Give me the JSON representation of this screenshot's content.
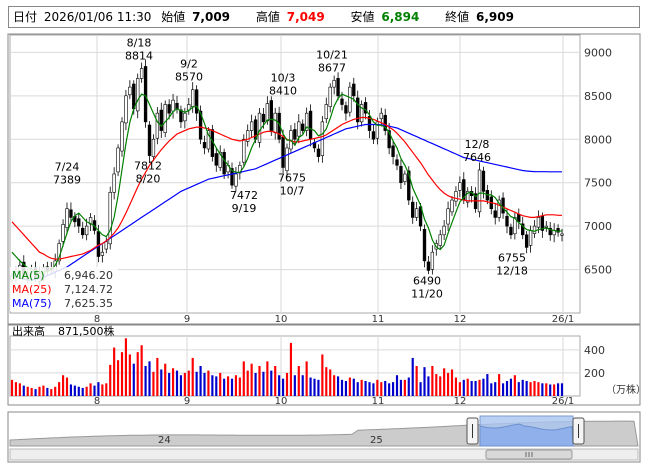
{
  "header": {
    "date_label": "日付",
    "date": "2026/01/06 11:30",
    "open_label": "始値",
    "open": "7,009",
    "high_label": "高値",
    "high": "7,049",
    "low_label": "安値",
    "low": "6,894",
    "close_label": "終値",
    "close": "6,909"
  },
  "colors": {
    "up": "#ff0000",
    "down": "#0000cc",
    "ma5": "#008000",
    "ma25": "#ff0000",
    "ma75": "#0000ff",
    "high_value": "#ff0000",
    "low_value": "#008000"
  },
  "chart_data": [
    {
      "type": "candlestick",
      "y_ticks": [
        "9000",
        "8500",
        "8000",
        "7500",
        "7000",
        "6500"
      ],
      "ylim": [
        6000,
        9200
      ],
      "x_ticks": [
        "8",
        "9",
        "10",
        "11",
        "12",
        "26/1"
      ],
      "legend": [
        {
          "label": "MA(5)",
          "value": "6,946.20"
        },
        {
          "label": "MA(25)",
          "value": "7,124.72"
        },
        {
          "label": "MA(75)",
          "value": "7,625.35"
        }
      ],
      "annotations": [
        {
          "lines": [
            "7/24",
            "7389"
          ],
          "value": 7389
        },
        {
          "lines": [
            "8/18",
            "8814"
          ],
          "value": 8814
        },
        {
          "lines": [
            "7812",
            "8/20"
          ],
          "value": 7812
        },
        {
          "lines": [
            "9/2",
            "8570"
          ],
          "value": 8570
        },
        {
          "lines": [
            "7472",
            "9/19"
          ],
          "value": 7472
        },
        {
          "lines": [
            "10/3",
            "8410"
          ],
          "value": 8410
        },
        {
          "lines": [
            "7675",
            "10/7"
          ],
          "value": 7675
        },
        {
          "lines": [
            "10/21",
            "8677"
          ],
          "value": 8677
        },
        {
          "lines": [
            "6490",
            "11/20"
          ],
          "value": 6490
        },
        {
          "lines": [
            "12/8",
            "7646"
          ],
          "value": 7646
        },
        {
          "lines": [
            "6755",
            "12/18"
          ],
          "value": 6755
        }
      ],
      "closes": [
        6420,
        6480,
        6550,
        6420,
        6460,
        6500,
        6400,
        6450,
        6520,
        6480,
        6500,
        6600,
        6800,
        7020,
        7200,
        7100,
        7050,
        7000,
        6900,
        7000,
        7100,
        6950,
        6650,
        6700,
        6820,
        7389,
        7600,
        7900,
        8200,
        8500,
        8600,
        8350,
        8700,
        8814,
        8200,
        7812,
        8000,
        8300,
        8100,
        8400,
        8300,
        8450,
        8350,
        8200,
        8300,
        8400,
        8570,
        8300,
        8000,
        7900,
        8100,
        7800,
        7700,
        7850,
        7600,
        7700,
        7472,
        7600,
        7700,
        8000,
        8100,
        8200,
        8000,
        8300,
        8200,
        8410,
        8100,
        8300,
        8000,
        7675,
        7900,
        8100,
        8000,
        8200,
        8100,
        8300,
        8000,
        7900,
        7800,
        8200,
        8400,
        8600,
        8677,
        8500,
        8400,
        8300,
        8600,
        8500,
        8200,
        8400,
        8300,
        8100,
        8000,
        8200,
        8300,
        8100,
        7900,
        7800,
        7700,
        7500,
        7600,
        7300,
        7100,
        7200,
        7000,
        6600,
        6490,
        6700,
        6800,
        6900,
        7000,
        7200,
        7300,
        7400,
        7500,
        7300,
        7400,
        7350,
        7200,
        7646,
        7400,
        7300,
        7200,
        7100,
        7300,
        7150,
        7000,
        6900,
        7100,
        7050,
        6900,
        6755,
        6950,
        7000,
        7100,
        6950,
        7000,
        6900,
        6950,
        6930,
        6909
      ],
      "ma5": [
        6700,
        6650,
        6600,
        6560,
        6520,
        6500,
        6480,
        6470,
        6470,
        6480,
        6500,
        6550,
        6640,
        6780,
        6920,
        7050,
        7120,
        7150,
        7100,
        7050,
        7030,
        7000,
        6950,
        6900,
        6880,
        6950,
        7100,
        7350,
        7650,
        7950,
        8200,
        8350,
        8450,
        8520,
        8500,
        8400,
        8300,
        8200,
        8150,
        8200,
        8250,
        8320,
        8350,
        8330,
        8310,
        8330,
        8370,
        8380,
        8300,
        8180,
        8050,
        7980,
        7900,
        7830,
        7760,
        7700,
        7640,
        7620,
        7620,
        7680,
        7780,
        7900,
        8000,
        8100,
        8160,
        8220,
        8230,
        8220,
        8180,
        8060,
        7990,
        7990,
        7930,
        8020,
        8050,
        8140,
        8120,
        8100,
        8040,
        8060,
        8120,
        8240,
        8380,
        8470,
        8520,
        8500,
        8480,
        8460,
        8400,
        8360,
        8340,
        8280,
        8200,
        8160,
        8160,
        8140,
        8080,
        7980,
        7900,
        7780,
        7700,
        7600,
        7440,
        7340,
        7240,
        7080,
        6980,
        6840,
        6760,
        6730,
        6780,
        6920,
        7040,
        7160,
        7280,
        7330,
        7380,
        7390,
        7340,
        7380,
        7380,
        7360,
        7360,
        7330,
        7260,
        7210,
        7160,
        7110,
        7090,
        7040,
        7000,
        6960,
        6950,
        6940,
        6960,
        6970,
        6980,
        6960,
        6950,
        6940,
        6946
      ],
      "ma25": [
        7050,
        7000,
        6950,
        6900,
        6850,
        6800,
        6750,
        6700,
        6680,
        6650,
        6630,
        6620,
        6620,
        6630,
        6640,
        6650,
        6660,
        6670,
        6680,
        6700,
        6720,
        6750,
        6780,
        6800,
        6830,
        6870,
        6920,
        6980,
        7060,
        7150,
        7250,
        7350,
        7450,
        7540,
        7620,
        7700,
        7760,
        7820,
        7880,
        7930,
        7980,
        8020,
        8060,
        8080,
        8100,
        8120,
        8130,
        8140,
        8140,
        8130,
        8120,
        8100,
        8080,
        8060,
        8040,
        8020,
        8000,
        7990,
        7980,
        7990,
        8000,
        8020,
        8040,
        8060,
        8080,
        8090,
        8090,
        8080,
        8060,
        8030,
        8000,
        7980,
        7970,
        7970,
        7980,
        7990,
        8000,
        8010,
        8020,
        8030,
        8050,
        8080,
        8110,
        8140,
        8170,
        8190,
        8210,
        8230,
        8240,
        8250,
        8250,
        8240,
        8230,
        8210,
        8190,
        8170,
        8140,
        8110,
        8070,
        8020,
        7970,
        7910,
        7850,
        7790,
        7730,
        7660,
        7590,
        7530,
        7470,
        7420,
        7380,
        7350,
        7330,
        7320,
        7310,
        7300,
        7290,
        7290,
        7290,
        7290,
        7290,
        7280,
        7270,
        7260,
        7240,
        7220,
        7200,
        7180,
        7160,
        7140,
        7120,
        7110,
        7100,
        7100,
        7110,
        7120,
        7130,
        7130,
        7130,
        7125,
        7125
      ],
      "ma75": [
        6450,
        6420,
        6400,
        6390,
        6380,
        6380,
        6390,
        6400,
        6410,
        6430,
        6450,
        6470,
        6490,
        6510,
        6530,
        6560,
        6590,
        6620,
        6650,
        6680,
        6710,
        6740,
        6770,
        6800,
        6830,
        6860,
        6890,
        6920,
        6950,
        6980,
        7010,
        7040,
        7070,
        7100,
        7130,
        7160,
        7190,
        7220,
        7250,
        7280,
        7310,
        7340,
        7370,
        7400,
        7420,
        7440,
        7460,
        7480,
        7500,
        7520,
        7540,
        7550,
        7560,
        7570,
        7580,
        7590,
        7600,
        7610,
        7620,
        7630,
        7640,
        7650,
        7660,
        7680,
        7700,
        7720,
        7740,
        7760,
        7780,
        7800,
        7820,
        7840,
        7860,
        7880,
        7900,
        7920,
        7940,
        7960,
        7980,
        8000,
        8020,
        8040,
        8060,
        8080,
        8100,
        8120,
        8130,
        8140,
        8150,
        8160,
        8170,
        8170,
        8170,
        8170,
        8165,
        8160,
        8150,
        8140,
        8130,
        8110,
        8090,
        8070,
        8050,
        8030,
        8010,
        7990,
        7970,
        7950,
        7930,
        7910,
        7890,
        7870,
        7850,
        7830,
        7810,
        7790,
        7780,
        7770,
        7760,
        7750,
        7740,
        7730,
        7720,
        7710,
        7700,
        7690,
        7680,
        7670,
        7660,
        7650,
        7640,
        7635,
        7630,
        7628,
        7627,
        7626,
        7626,
        7625,
        7625,
        7625,
        7625
      ]
    },
    {
      "type": "bar",
      "title": "出来高",
      "total": "871,500株",
      "unit": "（万株）",
      "y_ticks": [
        "400",
        "200"
      ],
      "ylim": [
        0,
        520
      ],
      "x_ticks": [
        "8",
        "9",
        "10",
        "11",
        "12",
        "26/1"
      ],
      "values": [
        140,
        120,
        110,
        90,
        80,
        70,
        60,
        80,
        90,
        70,
        60,
        80,
        120,
        180,
        160,
        100,
        90,
        80,
        70,
        80,
        110,
        90,
        120,
        100,
        110,
        270,
        420,
        310,
        380,
        500,
        360,
        280,
        380,
        440,
        260,
        300,
        210,
        330,
        230,
        280,
        200,
        240,
        220,
        180,
        200,
        220,
        330,
        210,
        260,
        200,
        220,
        180,
        170,
        200,
        150,
        170,
        150,
        180,
        160,
        300,
        220,
        280,
        200,
        260,
        210,
        300,
        220,
        260,
        180,
        150,
        200,
        460,
        180,
        260,
        180,
        300,
        160,
        150,
        140,
        360,
        250,
        230,
        180,
        170,
        140,
        130,
        160,
        150,
        120,
        140,
        130,
        120,
        110,
        140,
        120,
        130,
        110,
        120,
        180,
        140,
        140,
        160,
        330,
        260,
        120,
        250,
        170,
        260,
        190,
        170,
        240,
        200,
        230,
        160,
        120,
        140,
        150,
        130,
        130,
        140,
        150,
        190,
        110,
        120,
        190,
        110,
        130,
        150,
        180,
        120,
        140,
        130,
        120,
        130,
        120,
        110,
        110,
        100,
        100,
        110,
        110
      ]
    }
  ],
  "navigator": {
    "labels": [
      "24",
      "25"
    ]
  }
}
